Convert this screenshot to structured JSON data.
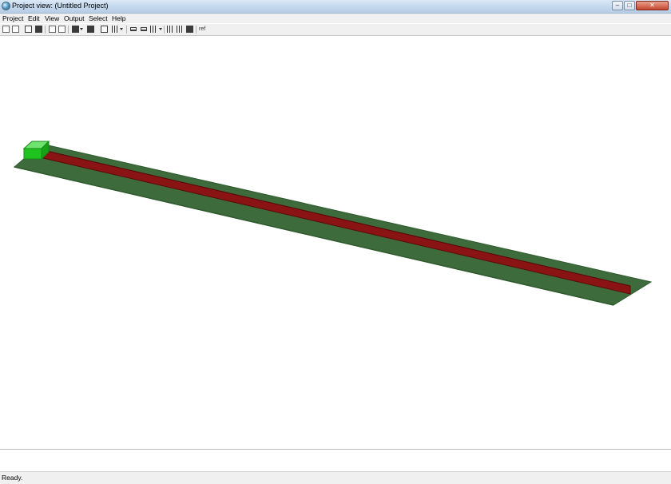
{
  "window": {
    "title": "Project view: (Untitled Project)",
    "minimize_glyph": "–",
    "maximize_glyph": "□",
    "close_glyph": "✕"
  },
  "menu": {
    "items": [
      {
        "label": "Project"
      },
      {
        "label": "Edit"
      },
      {
        "label": "View"
      },
      {
        "label": "Output"
      },
      {
        "label": "Select"
      },
      {
        "label": "Help"
      }
    ]
  },
  "toolbar": {
    "buttons": [
      {
        "icon": "new-document-icon"
      },
      {
        "icon": "duplicate-icon"
      },
      {
        "icon": "import-icon"
      },
      {
        "icon": "export-icon"
      },
      {
        "icon": "copy-icon"
      },
      {
        "icon": "paste-icon"
      },
      {
        "icon": "display-mode-icon"
      },
      {
        "icon": "render-icon"
      },
      {
        "icon": "reset-view-icon"
      },
      {
        "icon": "grid-icon"
      },
      {
        "icon": "move-right-icon"
      },
      {
        "icon": "move-left-icon"
      },
      {
        "icon": "align-icon"
      },
      {
        "icon": "analysis-icon"
      },
      {
        "icon": "spectrum-icon"
      },
      {
        "icon": "calibrate-icon"
      },
      {
        "icon": "scale-icon"
      }
    ],
    "last_label": "ref"
  },
  "scene": {
    "ground_color": "#3d6b3b",
    "ground_edge_color": "#2f5a2e",
    "barrier_color": "#8a1414",
    "barrier_dark_color": "#5a0a0a",
    "source_color": "#1fc21f",
    "source_top_color": "#6fe26f"
  },
  "status": {
    "text": "Ready."
  }
}
